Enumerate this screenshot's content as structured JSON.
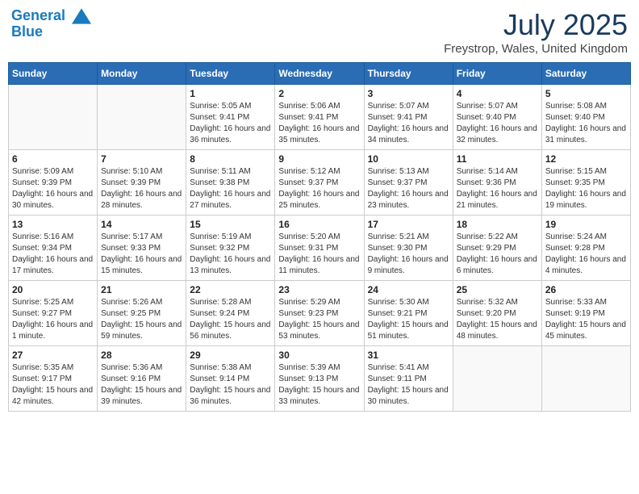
{
  "logo": {
    "line1": "General",
    "line2": "Blue"
  },
  "title": "July 2025",
  "location": "Freystrop, Wales, United Kingdom",
  "weekdays": [
    "Sunday",
    "Monday",
    "Tuesday",
    "Wednesday",
    "Thursday",
    "Friday",
    "Saturday"
  ],
  "weeks": [
    [
      {
        "day": "",
        "detail": ""
      },
      {
        "day": "",
        "detail": ""
      },
      {
        "day": "1",
        "detail": "Sunrise: 5:05 AM\nSunset: 9:41 PM\nDaylight: 16 hours and 36 minutes."
      },
      {
        "day": "2",
        "detail": "Sunrise: 5:06 AM\nSunset: 9:41 PM\nDaylight: 16 hours and 35 minutes."
      },
      {
        "day": "3",
        "detail": "Sunrise: 5:07 AM\nSunset: 9:41 PM\nDaylight: 16 hours and 34 minutes."
      },
      {
        "day": "4",
        "detail": "Sunrise: 5:07 AM\nSunset: 9:40 PM\nDaylight: 16 hours and 32 minutes."
      },
      {
        "day": "5",
        "detail": "Sunrise: 5:08 AM\nSunset: 9:40 PM\nDaylight: 16 hours and 31 minutes."
      }
    ],
    [
      {
        "day": "6",
        "detail": "Sunrise: 5:09 AM\nSunset: 9:39 PM\nDaylight: 16 hours and 30 minutes."
      },
      {
        "day": "7",
        "detail": "Sunrise: 5:10 AM\nSunset: 9:39 PM\nDaylight: 16 hours and 28 minutes."
      },
      {
        "day": "8",
        "detail": "Sunrise: 5:11 AM\nSunset: 9:38 PM\nDaylight: 16 hours and 27 minutes."
      },
      {
        "day": "9",
        "detail": "Sunrise: 5:12 AM\nSunset: 9:37 PM\nDaylight: 16 hours and 25 minutes."
      },
      {
        "day": "10",
        "detail": "Sunrise: 5:13 AM\nSunset: 9:37 PM\nDaylight: 16 hours and 23 minutes."
      },
      {
        "day": "11",
        "detail": "Sunrise: 5:14 AM\nSunset: 9:36 PM\nDaylight: 16 hours and 21 minutes."
      },
      {
        "day": "12",
        "detail": "Sunrise: 5:15 AM\nSunset: 9:35 PM\nDaylight: 16 hours and 19 minutes."
      }
    ],
    [
      {
        "day": "13",
        "detail": "Sunrise: 5:16 AM\nSunset: 9:34 PM\nDaylight: 16 hours and 17 minutes."
      },
      {
        "day": "14",
        "detail": "Sunrise: 5:17 AM\nSunset: 9:33 PM\nDaylight: 16 hours and 15 minutes."
      },
      {
        "day": "15",
        "detail": "Sunrise: 5:19 AM\nSunset: 9:32 PM\nDaylight: 16 hours and 13 minutes."
      },
      {
        "day": "16",
        "detail": "Sunrise: 5:20 AM\nSunset: 9:31 PM\nDaylight: 16 hours and 11 minutes."
      },
      {
        "day": "17",
        "detail": "Sunrise: 5:21 AM\nSunset: 9:30 PM\nDaylight: 16 hours and 9 minutes."
      },
      {
        "day": "18",
        "detail": "Sunrise: 5:22 AM\nSunset: 9:29 PM\nDaylight: 16 hours and 6 minutes."
      },
      {
        "day": "19",
        "detail": "Sunrise: 5:24 AM\nSunset: 9:28 PM\nDaylight: 16 hours and 4 minutes."
      }
    ],
    [
      {
        "day": "20",
        "detail": "Sunrise: 5:25 AM\nSunset: 9:27 PM\nDaylight: 16 hours and 1 minute."
      },
      {
        "day": "21",
        "detail": "Sunrise: 5:26 AM\nSunset: 9:25 PM\nDaylight: 15 hours and 59 minutes."
      },
      {
        "day": "22",
        "detail": "Sunrise: 5:28 AM\nSunset: 9:24 PM\nDaylight: 15 hours and 56 minutes."
      },
      {
        "day": "23",
        "detail": "Sunrise: 5:29 AM\nSunset: 9:23 PM\nDaylight: 15 hours and 53 minutes."
      },
      {
        "day": "24",
        "detail": "Sunrise: 5:30 AM\nSunset: 9:21 PM\nDaylight: 15 hours and 51 minutes."
      },
      {
        "day": "25",
        "detail": "Sunrise: 5:32 AM\nSunset: 9:20 PM\nDaylight: 15 hours and 48 minutes."
      },
      {
        "day": "26",
        "detail": "Sunrise: 5:33 AM\nSunset: 9:19 PM\nDaylight: 15 hours and 45 minutes."
      }
    ],
    [
      {
        "day": "27",
        "detail": "Sunrise: 5:35 AM\nSunset: 9:17 PM\nDaylight: 15 hours and 42 minutes."
      },
      {
        "day": "28",
        "detail": "Sunrise: 5:36 AM\nSunset: 9:16 PM\nDaylight: 15 hours and 39 minutes."
      },
      {
        "day": "29",
        "detail": "Sunrise: 5:38 AM\nSunset: 9:14 PM\nDaylight: 15 hours and 36 minutes."
      },
      {
        "day": "30",
        "detail": "Sunrise: 5:39 AM\nSunset: 9:13 PM\nDaylight: 15 hours and 33 minutes."
      },
      {
        "day": "31",
        "detail": "Sunrise: 5:41 AM\nSunset: 9:11 PM\nDaylight: 15 hours and 30 minutes."
      },
      {
        "day": "",
        "detail": ""
      },
      {
        "day": "",
        "detail": ""
      }
    ]
  ]
}
